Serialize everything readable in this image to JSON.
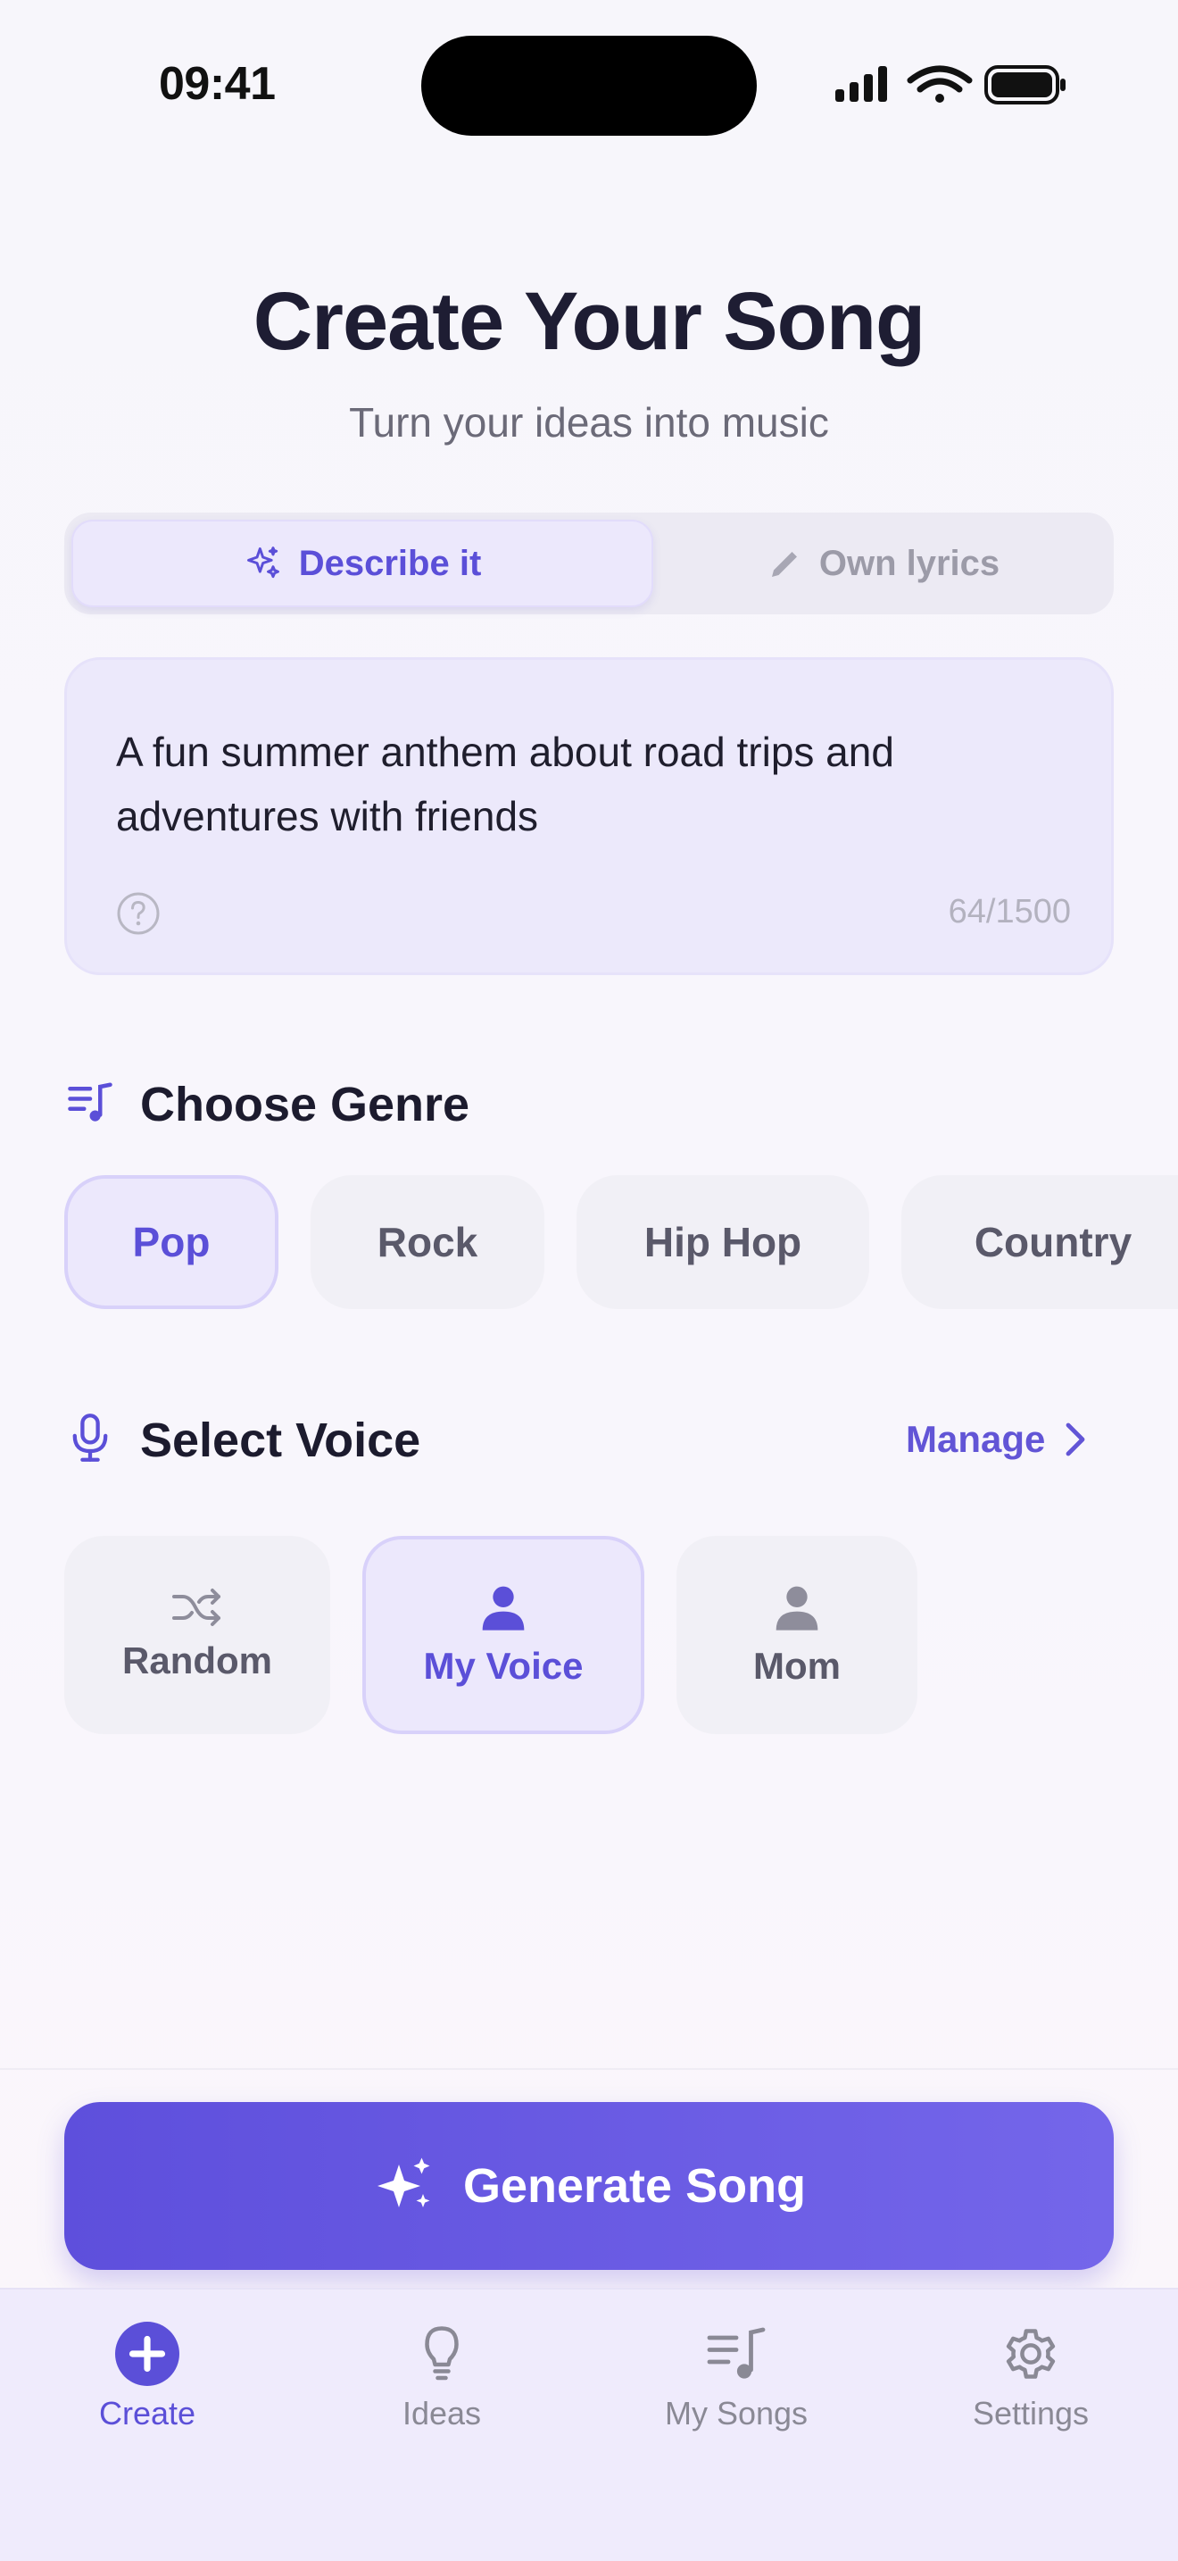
{
  "status_bar": {
    "time": "09:41"
  },
  "header": {
    "title": "Create Your Song",
    "subtitle": "Turn your ideas into music"
  },
  "mode_toggle": {
    "describe_label": "Describe it",
    "describe_icon": "sparkles-icon",
    "lyrics_label": "Own lyrics",
    "lyrics_icon": "pencil-icon",
    "selected": "Describe it"
  },
  "prompt": {
    "text": "A fun summer anthem about road trips and adventures with friends",
    "char_count": "64/1500",
    "help_icon": "question-circle-icon"
  },
  "genre": {
    "title": "Choose Genre",
    "icon": "music-list-icon",
    "options": [
      "Pop",
      "Rock",
      "Hip Hop",
      "Country"
    ],
    "selected": "Pop"
  },
  "voice": {
    "title": "Select Voice",
    "icon": "microphone-icon",
    "manage_label": "Manage",
    "options": [
      {
        "label": "Random",
        "icon": "shuffle-icon"
      },
      {
        "label": "My Voice",
        "icon": "person-icon"
      },
      {
        "label": "Mom",
        "icon": "person-icon"
      }
    ],
    "selected": "My Voice"
  },
  "generate": {
    "label": "Generate Song",
    "icon": "sparkles-icon"
  },
  "tab_bar": {
    "items": [
      {
        "label": "Create",
        "icon": "plus-circle-icon"
      },
      {
        "label": "Ideas",
        "icon": "lightbulb-icon"
      },
      {
        "label": "My Songs",
        "icon": "music-list-icon"
      },
      {
        "label": "Settings",
        "icon": "gear-icon"
      }
    ],
    "active": "Create"
  },
  "colors": {
    "accent": "#5b4fd8",
    "accent_light": "#ece8fc",
    "text_primary": "#1c1b2e",
    "text_secondary": "#6b6a78"
  }
}
